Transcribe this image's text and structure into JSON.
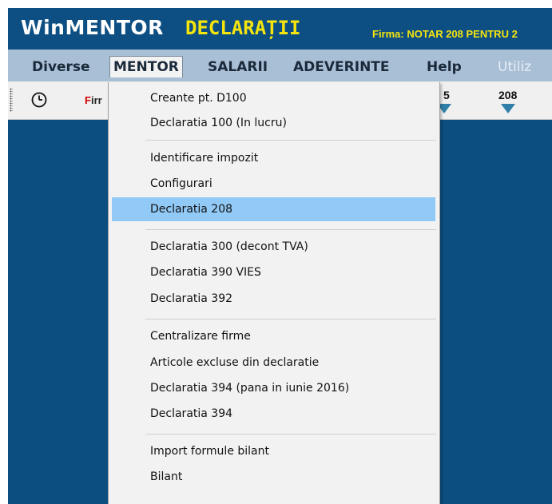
{
  "title_bar": {
    "logo_win": "WinMENTOR",
    "logo_declaratii": "DECLARAȚII",
    "firma": "Firma: NOTAR 208 PENTRU 2"
  },
  "menubar": {
    "items": [
      {
        "label": "Diverse"
      },
      {
        "label": "MENTOR"
      },
      {
        "label": "SALARII"
      },
      {
        "label": "ADEVERINTE"
      },
      {
        "label": "Help"
      },
      {
        "label": "Utiliz"
      }
    ]
  },
  "toolbar": {
    "firm_label_first": "F",
    "firm_label_rest": "irr",
    "button_5_label": "5",
    "button_208_label": "208"
  },
  "dropdown": {
    "items": [
      {
        "label": "Creante pt. D100"
      },
      {
        "label": "Declaratia 100 (In lucru)"
      },
      {
        "label": "Identificare impozit"
      },
      {
        "label": "Configurari"
      },
      {
        "label": "Declaratia 208",
        "highlighted": true
      },
      {
        "label": "Declaratia 300 (decont TVA)"
      },
      {
        "label": "Declaratia 390 VIES"
      },
      {
        "label": "Declaratia 392"
      },
      {
        "label": "Centralizare firme"
      },
      {
        "label": "Articole excluse din declaratie"
      },
      {
        "label": "Declaratia 394 (pana in iunie 2016)"
      },
      {
        "label": "Declaratia 394"
      },
      {
        "label": "Import formule bilant"
      },
      {
        "label": "Bilant"
      }
    ]
  },
  "colors": {
    "workspace": "#0c4e80",
    "menubar": "#a9bfd6",
    "logo_yellow": "#f6e50d",
    "highlight": "#91c9f7"
  }
}
